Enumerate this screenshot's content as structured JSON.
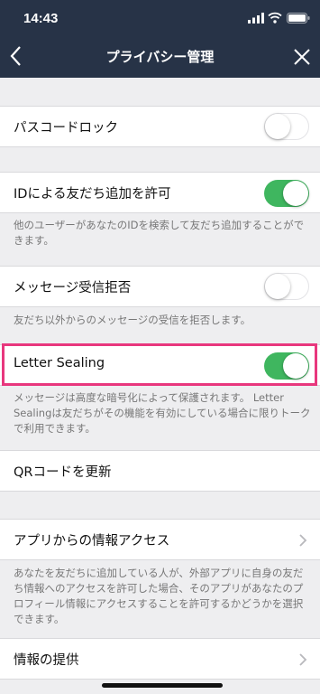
{
  "status_bar": {
    "time": "14:43"
  },
  "nav": {
    "title": "プライバシー管理",
    "back_icon": "chevron-left-icon",
    "close_icon": "close-icon"
  },
  "settings": {
    "passcode": {
      "label": "パスコードロック",
      "enabled": false
    },
    "allow_id_add": {
      "label": "IDによる友だち追加を許可",
      "enabled": true,
      "note": "他のユーザーがあなたのIDを検索して友だち追加することができます。"
    },
    "reject_messages": {
      "label": "メッセージ受信拒否",
      "enabled": false,
      "note": "友だち以外からのメッセージの受信を拒否します。"
    },
    "letter_sealing": {
      "label": "Letter Sealing",
      "enabled": true,
      "note": "メッセージは高度な暗号化によって保護されます。 Letter Sealingは友だちがその機能を有効にしている場合に限りトークで利用できます。"
    },
    "qr_update": {
      "label": "QRコードを更新"
    },
    "app_access": {
      "label": "アプリからの情報アクセス",
      "note": "あなたを友だちに追加している人が、外部アプリに自身の友だち情報へのアクセスを許可した場合、そのアプリがあなたのプロフィール情報にアクセスすることを許可するかどうかを選択できます。"
    },
    "info_provision": {
      "label": "情報の提供"
    }
  },
  "colors": {
    "nav_bg": "#273347",
    "toggle_on": "#3fb65f",
    "highlight": "#e8377d",
    "page_bg": "#eeeef0"
  }
}
